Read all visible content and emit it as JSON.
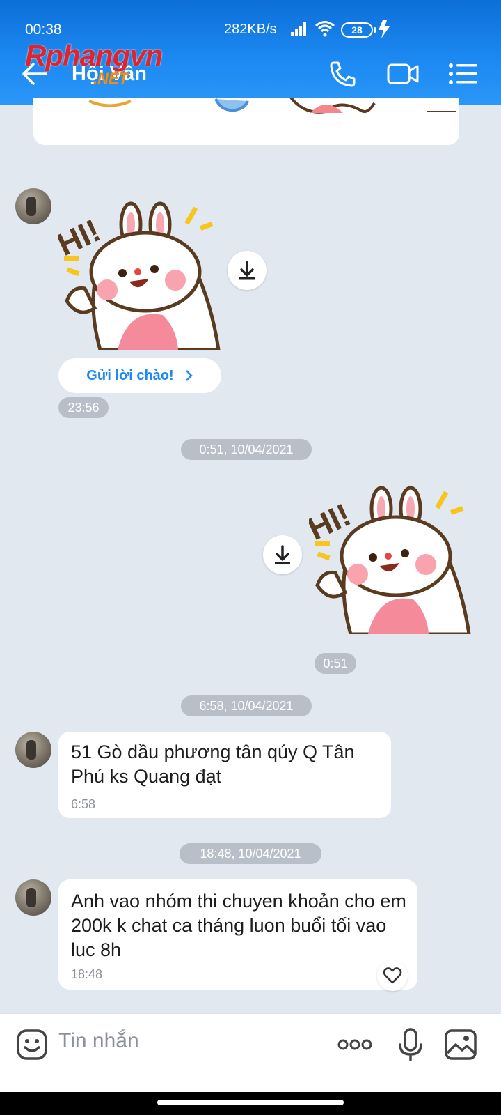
{
  "status_bar": {
    "time": "00:38",
    "speed": "282KB/s",
    "battery": "28"
  },
  "header": {
    "title": "Hội Vân",
    "watermark": "Rphangvn",
    "watermark_suffix": ".NET",
    "colors": {
      "bar": "#1d8af3",
      "background": "#e2e8ef"
    }
  },
  "messages": {
    "greet_button": "Gửi lời chào!",
    "greet_time": "23:56",
    "sep1": "0:51, 10/04/2021",
    "sticker_time": "0:51",
    "sep2": "6:58, 10/04/2021",
    "msg1_text": "51 Gò dầu phương tân qúy  Q Tân Phú ks Quang đạt",
    "msg1_time": "6:58",
    "sep3": "18:48, 10/04/2021",
    "msg2_text": "Anh vao nhóm thi chuyen khoản cho em  200k k chat ca tháng luon buổi tối vao luc 8h",
    "msg2_time": "18:48"
  },
  "composer": {
    "placeholder": "Tin nhắn"
  },
  "icons": [
    "back-arrow-icon",
    "phone-icon",
    "video-call-icon",
    "menu-list-icon",
    "download-icon",
    "heart-icon",
    "emoji-icon",
    "more-icon",
    "microphone-icon",
    "image-icon"
  ]
}
